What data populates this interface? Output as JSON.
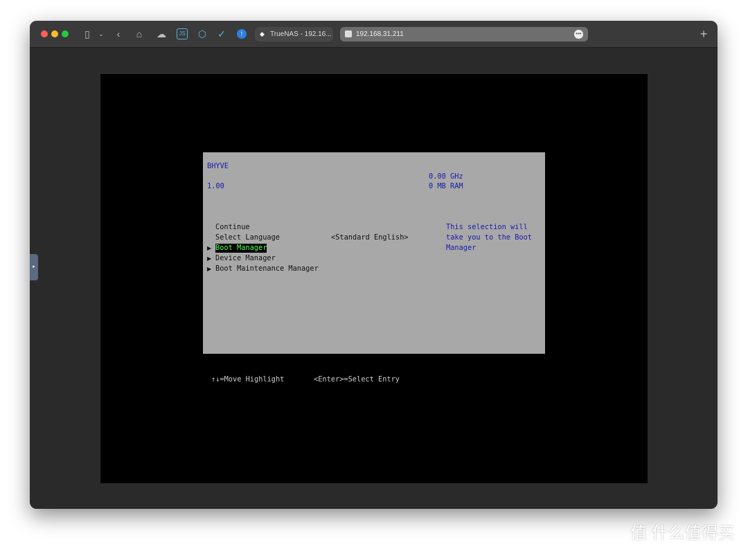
{
  "browser": {
    "tab_title": "TrueNAS - 192.16...",
    "address": "192.168.31.211",
    "new_tab": "+",
    "icons": [
      "sidebar-icon",
      "chevron-down-icon",
      "back-icon",
      "home-icon",
      "cloud-icon",
      "js-icon",
      "cube-icon",
      "check-icon",
      "password-icon",
      "more-icon"
    ]
  },
  "bios": {
    "vendor": "BHYVE",
    "version": "1.00",
    "cpu": "0.00 GHz",
    "ram": "0 MB RAM",
    "menu": [
      {
        "label": "Continue",
        "submenu": false
      },
      {
        "label": "Select Language",
        "value": "<Standard English>",
        "submenu": false
      },
      {
        "label": "Boot Manager",
        "submenu": true,
        "selected": true
      },
      {
        "label": "Device Manager",
        "submenu": true
      },
      {
        "label": "Boot Maintenance Manager",
        "submenu": true
      }
    ],
    "help": [
      "This selection will",
      "take you to the Boot",
      "Manager"
    ],
    "footer": {
      "move": "↑↓=Move Highlight",
      "enter": "<Enter>=Select Entry"
    }
  },
  "watermark": "值 什么值得买",
  "colors": {
    "bios_bg": "#a8a8a8",
    "text_blue": "#1a1aa8",
    "highlight": "#55ff55"
  }
}
